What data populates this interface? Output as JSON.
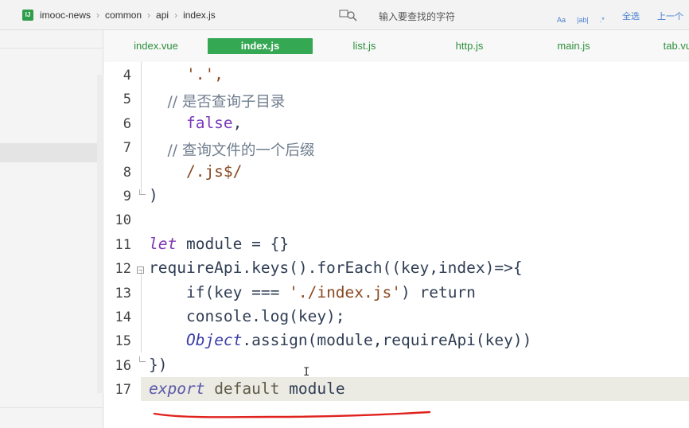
{
  "breadcrumb": {
    "project_icon": "IJ",
    "items": [
      "imooc-news",
      "common",
      "api",
      "index.js"
    ]
  },
  "find_bar": {
    "placeholder": "输入要查找的字符",
    "options": [
      "Aa",
      "|ab|",
      ".*"
    ],
    "select_all": "全选",
    "previous": "上一个"
  },
  "tabs": [
    {
      "label": "index.vue",
      "active": false
    },
    {
      "label": "index.js",
      "active": true
    },
    {
      "label": "list.js",
      "active": false
    },
    {
      "label": "http.js",
      "active": false
    },
    {
      "label": "main.js",
      "active": false
    },
    {
      "label": "tab.vue",
      "active": false
    }
  ],
  "editor": {
    "current_line": 17,
    "lines": [
      {
        "n": "4",
        "segments": [
          {
            "t": "    '.',",
            "c": "str"
          }
        ]
      },
      {
        "n": "5",
        "segments": [
          {
            "t": "    // 是否查询子目录",
            "c": "com"
          }
        ]
      },
      {
        "n": "6",
        "segments": [
          {
            "t": "    false",
            "c": "bool"
          },
          {
            "t": ",",
            "c": "plain"
          }
        ]
      },
      {
        "n": "7",
        "segments": [
          {
            "t": "    // 查询文件的一个后缀",
            "c": "com"
          }
        ]
      },
      {
        "n": "8",
        "segments": [
          {
            "t": "    /.js$/",
            "c": "str"
          }
        ]
      },
      {
        "n": "9",
        "segments": [
          {
            "t": ")",
            "c": "plain"
          }
        ]
      },
      {
        "n": "10",
        "segments": []
      },
      {
        "n": "11",
        "segments": [
          {
            "t": "let",
            "c": "key"
          },
          {
            "t": " module = {}",
            "c": "plain"
          }
        ]
      },
      {
        "n": "12",
        "segments": [
          {
            "t": "requireApi.keys().forEach((key,index)=>{",
            "c": "plain"
          }
        ]
      },
      {
        "n": "13",
        "segments": [
          {
            "t": "    if(key === ",
            "c": "plain"
          },
          {
            "t": "'./index.js'",
            "c": "str"
          },
          {
            "t": ") return",
            "c": "plain"
          }
        ]
      },
      {
        "n": "14",
        "segments": [
          {
            "t": "    console.log(key);",
            "c": "plain"
          }
        ]
      },
      {
        "n": "15",
        "segments": [
          {
            "t": "    ",
            "c": "plain"
          },
          {
            "t": "Object",
            "c": "obj"
          },
          {
            "t": ".assign(module,requireApi(key))",
            "c": "plain"
          }
        ]
      },
      {
        "n": "16",
        "segments": [
          {
            "t": "})",
            "c": "plain"
          }
        ]
      },
      {
        "n": "17",
        "segments": [
          {
            "t": "export",
            "c": "export"
          },
          {
            "t": " default ",
            "c": "def"
          },
          {
            "t": "module",
            "c": "plain"
          }
        ]
      }
    ]
  },
  "colors": {
    "tab_active_bg": "#35a853",
    "tab_text": "#2d8f3c",
    "annotation_red": "#e0221e"
  }
}
